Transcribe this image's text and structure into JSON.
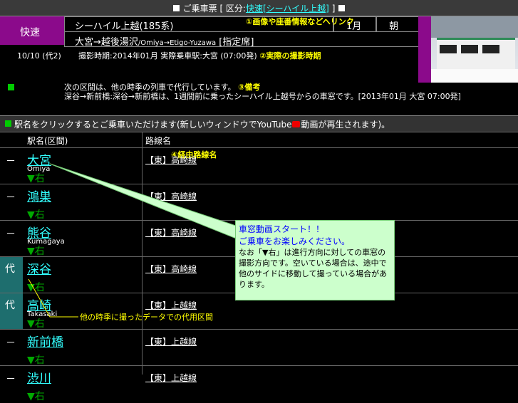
{
  "header": {
    "title_prefix": "ご乗車票 [ 区分:",
    "title_link": "快速[シーハイル上越]",
    "title_suffix": " ]"
  },
  "ticket": {
    "category": "快速",
    "train_name": "シーハイル上越(185系)",
    "month": "1月",
    "time_of_day": "朝",
    "route": "大宮→越後湯沢",
    "route_romaji": "/Omiya→Etigo-Yuzawa",
    "seat": " [指定席]",
    "date_code": "10/10 (代2)",
    "shoot_info": "撮影時期:2014年01月 実際乗車駅:大宮 (07:00発)"
  },
  "annotations": {
    "a1": "①画像や座番情報などへリンク",
    "a2": "②実際の撮影時期",
    "a3": "③備考",
    "a4": "④経由路線名",
    "a5": "他の時季に撮ったデータでの代用区間"
  },
  "remarks": {
    "line1": "次の区間は、他の時季の列車で代行しています。",
    "line2": "深谷→新前橋:深谷→新前橋は、1週間前に乗ったシーハイル上越号からの車窓です。[2013年01月 大宮 07:00発]"
  },
  "table": {
    "caption_before": "駅名をクリックするとご乗車いただけます(新しいウィンドウでYouTube",
    "caption_after": "動画が再生されます)。",
    "col_station": "駅名(区間)",
    "col_line": "路線名",
    "dir_label": "▼右",
    "dash": "－",
    "sub_mark": "代",
    "rows": [
      {
        "name": "大宮",
        "romaji": "Omiya",
        "line": "【東】高崎線",
        "sub": false
      },
      {
        "name": "鴻巣",
        "romaji": "",
        "line": "【東】高崎線",
        "sub": false
      },
      {
        "name": "熊谷",
        "romaji": "Kumagaya",
        "line": "【東】高崎線",
        "sub": false
      },
      {
        "name": "深谷",
        "romaji": "",
        "line": "【東】高崎線",
        "sub": true
      },
      {
        "name": "高崎",
        "romaji": "Takasaki",
        "line": "【東】上越線",
        "sub": true
      },
      {
        "name": "新前橋",
        "romaji": "",
        "line": "【東】上越線",
        "sub": false
      },
      {
        "name": "渋川",
        "romaji": "",
        "line": "【東】上越線",
        "sub": false
      }
    ]
  },
  "callout": {
    "title": "車窓動画スタート！！",
    "subtitle": "ご乗車をお楽しみください。",
    "body": "なお「▼右」は進行方向に対しての車窓の撮影方向です。空いている場合は、途中で他のサイドに移動して撮っている場合があります。"
  },
  "youtube_icon": "youtube-icon",
  "colors": {
    "accent_purple": "#8b0a8b",
    "link": "#33ffff",
    "callout_bg": "#ccffcc",
    "sub_bg": "#1e6e6e"
  }
}
